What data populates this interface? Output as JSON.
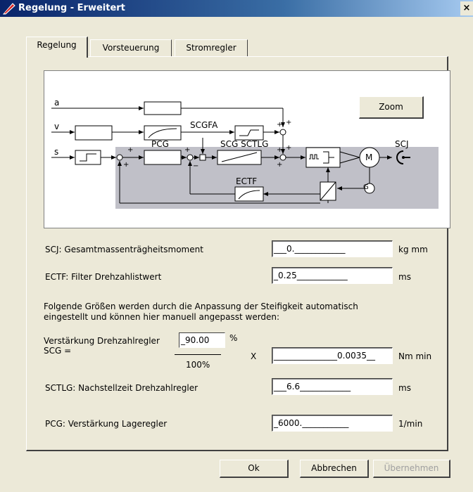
{
  "window": {
    "title": "Regelung - Erweitert",
    "close_glyph": "×"
  },
  "tabs": [
    {
      "label": "Regelung",
      "active": true
    },
    {
      "label": "Vorsteuerung",
      "active": false
    },
    {
      "label": "Stromregler",
      "active": false
    }
  ],
  "diagram": {
    "zoom_label": "Zoom",
    "labels": {
      "a": "a",
      "v": "v",
      "s": "s",
      "pcg": "PCG",
      "scgfa": "SCGFA",
      "scg_sctlg": "SCG  SCTLG",
      "ectf": "ECTF",
      "scj": "SCJ",
      "motor": "M",
      "plus": "+",
      "minus": "−"
    }
  },
  "fields": {
    "scj": {
      "label": "SCJ: Gesamtmassenträgheitsmoment",
      "value": "___0.____________",
      "unit": "kg mm"
    },
    "ectf": {
      "label": "ECTF: Filter Drehzahlistwert",
      "value": "_0.25____________",
      "unit": "ms"
    },
    "info_text_1": "Folgende Größen werden durch die Anpassung der Steifigkeit automatisch",
    "info_text_2": "eingestellt und können hier manuell angepasst werden:",
    "scg": {
      "label_1": "Verstärkung Drehzahlregler",
      "label_2": "SCG =",
      "percent_value": "_90.00",
      "percent_sign": "%",
      "denominator": "100%",
      "times": "X",
      "value": "_______________0.0035__",
      "unit": "Nm min"
    },
    "sctlg": {
      "label": "SCTLG: Nachstellzeit Drehzahlregler",
      "value": "___6.6____________",
      "unit": "ms"
    },
    "pcg": {
      "label": "PCG: Verstärkung Lageregler",
      "value": "_6000.___________",
      "unit": "1/min"
    }
  },
  "buttons": {
    "ok": "Ok",
    "cancel": "Abbrechen",
    "apply": "Übernehmen"
  }
}
